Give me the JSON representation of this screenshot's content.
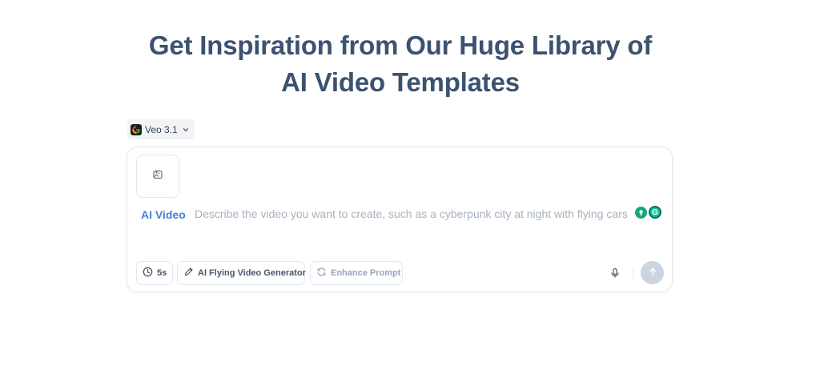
{
  "headline": {
    "line1": "Get Inspiration from Our Huge Library of",
    "line2": "AI Video Templates"
  },
  "model_selector": {
    "label": "Veo 3.1",
    "icon": "google-g-icon"
  },
  "composer": {
    "upload_icon": "image-plus-icon",
    "mode_label": "AI Video",
    "prompt_placeholder": "Describe the video you want to create, such as a cyberpunk city at night with flying cars",
    "prompt_value": "",
    "chips": {
      "duration": {
        "icon": "clock-icon",
        "label": "5s"
      },
      "generator": {
        "icon": "pencil-icon",
        "label": "AI Flying Video Generator"
      },
      "enhance": {
        "icon": "refresh-icon",
        "label": "Enhance Prompt"
      }
    },
    "mic_icon": "microphone-icon",
    "send_icon": "arrow-up-icon"
  },
  "extensions": {
    "icons": [
      "extension-badge-icon",
      "grammarly-icon"
    ],
    "grammarly_letter": "G"
  },
  "colors": {
    "headline": "#3b5270",
    "accent": "#4a7fd4",
    "send_disabled": "#cbd5e1",
    "grammarly": "#15c39a"
  }
}
